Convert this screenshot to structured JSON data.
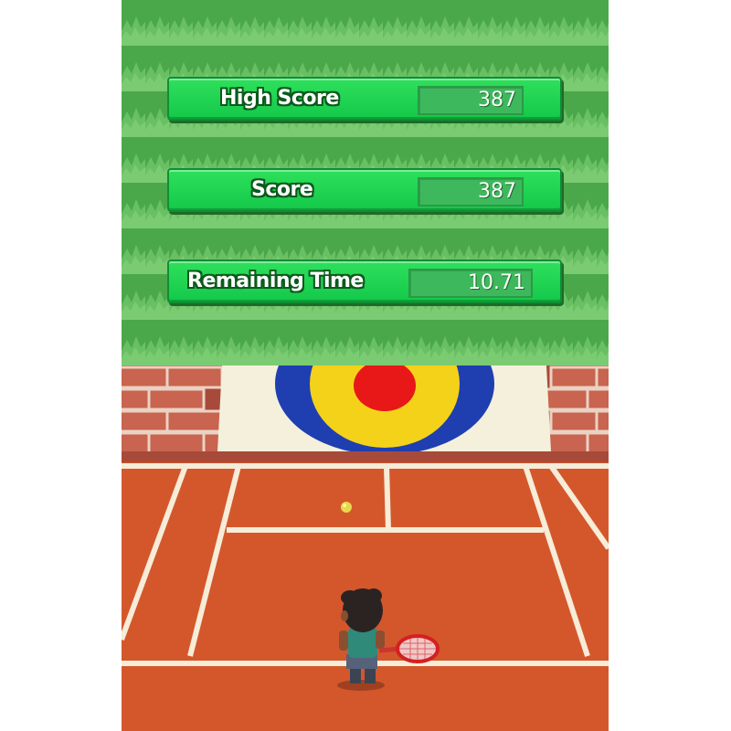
{
  "hud": {
    "high_score": {
      "label": "High Score",
      "value": "387"
    },
    "score": {
      "label": "Score",
      "value": "387"
    },
    "remaining_time": {
      "label": "Remaining Time",
      "value": "10.71"
    }
  },
  "colors": {
    "grass": "#47a547",
    "panel": "#14c84a",
    "court": "#d4572c",
    "court_lines": "#f7ecd8",
    "brick": "#c8644f",
    "target_blue": "#1f3fb0",
    "target_yellow": "#f5d21a",
    "target_red": "#e81818"
  },
  "scene": {
    "target": "bullseye-target",
    "ball": "tennis-ball",
    "player": "tennis-player-with-racket"
  }
}
